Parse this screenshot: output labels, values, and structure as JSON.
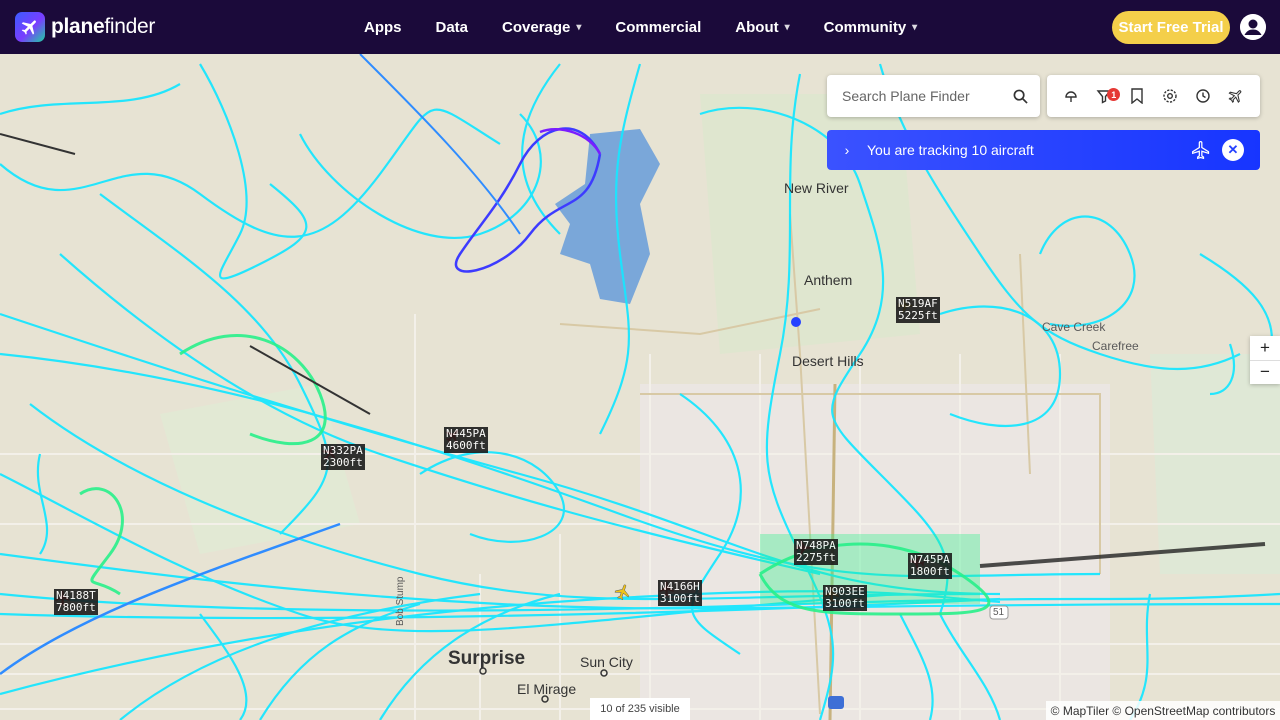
{
  "brand": {
    "name_prefix": "plane",
    "name_suffix": "finder"
  },
  "nav": {
    "items": [
      {
        "label": "Apps",
        "has_dropdown": false
      },
      {
        "label": "Data",
        "has_dropdown": false
      },
      {
        "label": "Coverage",
        "has_dropdown": true
      },
      {
        "label": "Commercial",
        "has_dropdown": false
      },
      {
        "label": "About",
        "has_dropdown": true
      },
      {
        "label": "Community",
        "has_dropdown": true
      }
    ]
  },
  "header": {
    "cta_label": "Start Free Trial"
  },
  "search": {
    "placeholder": "Search Plane Finder"
  },
  "toolbar": {
    "filter_badge": "1"
  },
  "tracking": {
    "text": "You are tracking 10 aircraft"
  },
  "places": {
    "new_river": "New River",
    "anthem": "Anthem",
    "desert_hills": "Desert Hills",
    "cave_creek": "Cave Creek",
    "carefree": "Carefree",
    "surprise": "Surprise",
    "sun_city": "Sun City",
    "el_mirage": "El Mirage",
    "bob_stump": "Bob Stump",
    "route_51": "51"
  },
  "aircraft": [
    {
      "callsign": "N519AF",
      "altitude": "5225ft",
      "color": "#f0c419"
    },
    {
      "callsign": "N445PA",
      "altitude": "4600ft",
      "color": "#d62828"
    },
    {
      "callsign": "N332PA",
      "altitude": "2300ft",
      "color": "#d62828"
    },
    {
      "callsign": "N748PA",
      "altitude": "2275ft",
      "color": "#d62828"
    },
    {
      "callsign": "N745PA",
      "altitude": "1800ft",
      "color": "#d62828"
    },
    {
      "callsign": "N4166H",
      "altitude": "3100ft",
      "color": "#d62828"
    },
    {
      "callsign": "N903EE",
      "altitude": "3100ft",
      "color": "#f0c419"
    },
    {
      "callsign": "N4188T",
      "altitude": "7800ft",
      "color": "#d62828"
    }
  ],
  "footer": {
    "visible_count": "10 of 235 visible",
    "attribution": "© MapTiler © OpenStreetMap contributors"
  },
  "colors": {
    "header_bg": "#1b0a3a",
    "cta": "#f4cf4a",
    "track_cyan": "#19e6ff",
    "track_green": "#28f08a",
    "tracking_bar": "#2541ff"
  }
}
